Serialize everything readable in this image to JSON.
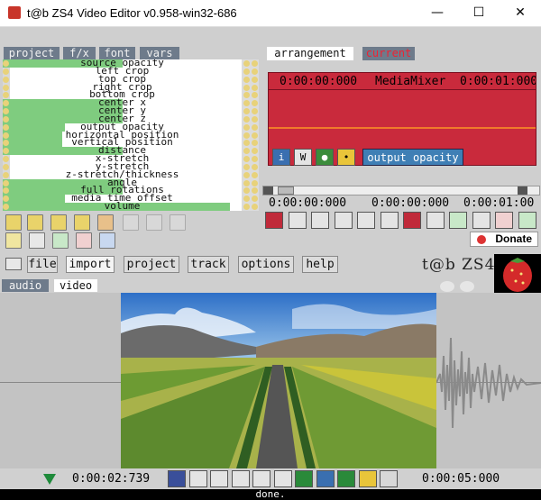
{
  "window": {
    "title": "t@b ZS4 Video Editor v0.958-win32-686",
    "minimize": "—",
    "maximize": "☐",
    "close": "✕"
  },
  "left_tabs": [
    "project",
    "f/x",
    "font",
    "vars"
  ],
  "properties": [
    {
      "label": "source opacity",
      "fill": 0.5
    },
    {
      "label": "left crop",
      "fill": 0
    },
    {
      "label": "top crop",
      "fill": 0
    },
    {
      "label": "right crop",
      "fill": 0
    },
    {
      "label": "bottom crop",
      "fill": 0
    },
    {
      "label": "center x",
      "fill": 0.5
    },
    {
      "label": "center y",
      "fill": 0.5
    },
    {
      "label": "center z",
      "fill": 0.5
    },
    {
      "label": "output opacity",
      "fill": 0.26
    },
    {
      "label": "horizontal position",
      "fill": 0.25
    },
    {
      "label": "vertical position",
      "fill": 0.25
    },
    {
      "label": "distance",
      "fill": 0.5
    },
    {
      "label": "x-stretch",
      "fill": 0
    },
    {
      "label": "y-stretch",
      "fill": 0
    },
    {
      "label": "z-stretch/thickness",
      "fill": 0
    },
    {
      "label": "angle",
      "fill": 0.5
    },
    {
      "label": "full rotations",
      "fill": 0.5
    },
    {
      "label": "media time offset",
      "fill": 0.26
    },
    {
      "label": "volume",
      "fill": 0.95
    }
  ],
  "arrangement": {
    "tabs": [
      "arrangement",
      "current"
    ],
    "timecode_start": "0:00:00:000",
    "media_label": "MediaMixer",
    "timecode_end": "0:00:01:000",
    "param_label": "output opacity",
    "ruler": [
      "0:00:00:000",
      "0:00:00:000",
      "0:00:01:00"
    ],
    "donate": "Donate"
  },
  "main_menu": [
    "file",
    "import",
    "project",
    "track",
    "options",
    "help"
  ],
  "logo_text": "t@b ZS4",
  "view_tabs": [
    "audio",
    "video"
  ],
  "transport": {
    "current_time": "0:00:02:739",
    "end_time": "0:00:05:000"
  },
  "status": "done."
}
